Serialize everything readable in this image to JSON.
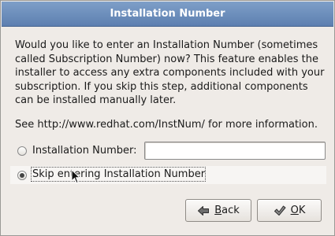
{
  "dialog": {
    "title": "Installation Number"
  },
  "description": {
    "lines": [
      "Would you like to enter an Installation Number (sometimes",
      "called Subscription Number) now? This feature enables the",
      "installer to access any extra components included with your",
      "subscription.  If you skip this step, additional components",
      "can be installed manually later."
    ],
    "more_info": "See http://www.redhat.com/InstNum/ for more information."
  },
  "options": {
    "installation_number": {
      "label": "Installation Number:",
      "checked": false,
      "value": ""
    },
    "skip": {
      "label": "Skip entering Installation Number",
      "checked": true
    }
  },
  "buttons": {
    "back": {
      "mnemonic": "B",
      "rest": "ack",
      "icon": "back-arrow-icon"
    },
    "ok": {
      "mnemonic": "O",
      "rest": "K",
      "icon": "ok-check-icon"
    }
  },
  "colors": {
    "titlebar": "#5d7fb0",
    "dialog_bg": "#efebe7"
  }
}
